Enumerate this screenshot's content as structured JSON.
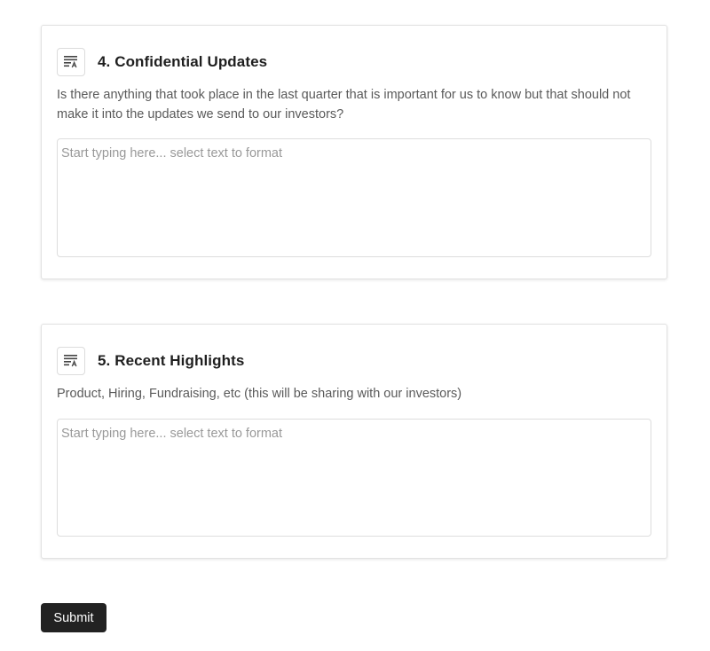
{
  "questions": [
    {
      "title": "4. Confidential Updates",
      "description": "Is there anything that took place in the last quarter that is important for us to know but that should not make it into the updates we send to our investors?",
      "placeholder": "Start typing here... select text to format",
      "icon": "long-text-icon"
    },
    {
      "title": "5. Recent Highlights",
      "description": "Product, Hiring, Fundraising, etc (this will be sharing with our investors)",
      "placeholder": "Start typing here... select text to format",
      "icon": "long-text-icon"
    }
  ],
  "submit_label": "Submit",
  "colors": {
    "button_bg": "#222222",
    "button_text": "#ffffff",
    "title_text": "#1f1f1f",
    "description_text": "#5a5a5a",
    "placeholder_text": "#999999",
    "border": "#dddddd"
  }
}
